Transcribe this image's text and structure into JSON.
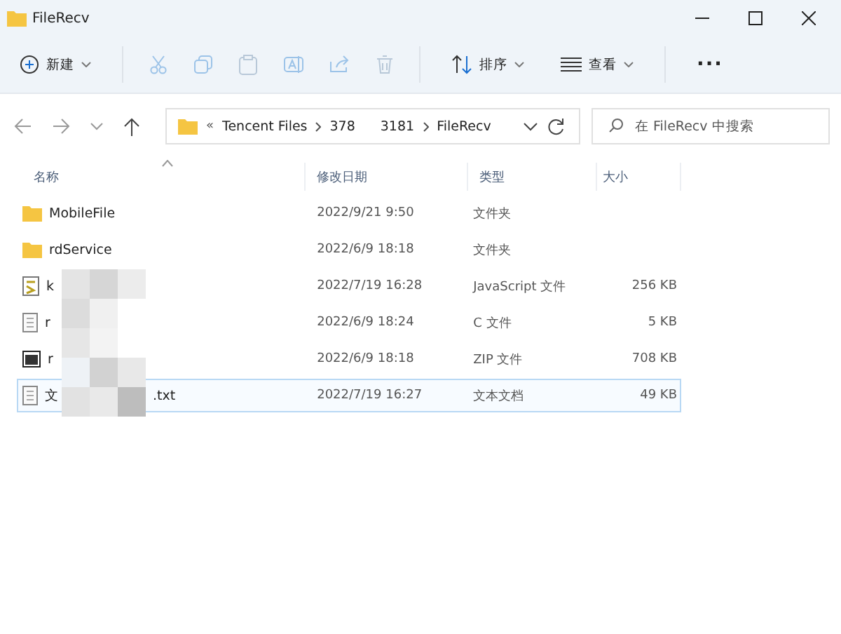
{
  "window": {
    "title": "FileRecv"
  },
  "toolbar": {
    "new_label": "新建",
    "sort_label": "排序",
    "view_label": "查看",
    "more": "···"
  },
  "address": {
    "prefix": "«",
    "crumbs": [
      "Tencent Files",
      "378",
      "3181",
      "FileRecv"
    ]
  },
  "search": {
    "placeholder": "在 FileRecv 中搜索"
  },
  "table": {
    "columns": [
      "名称",
      "修改日期",
      "类型",
      "大小"
    ],
    "rows": [
      {
        "kind": "folder",
        "name": "MobileFile",
        "suffix": "",
        "date": "2022/9/21 9:50",
        "type": "文件夹",
        "size": "",
        "selected": false
      },
      {
        "kind": "folder",
        "name": "rdService",
        "suffix": "",
        "date": "2022/6/9 18:18",
        "type": "文件夹",
        "size": "",
        "selected": false
      },
      {
        "kind": "js",
        "name": "k",
        "suffix": "",
        "date": "2022/7/19 16:28",
        "type": "JavaScript 文件",
        "size": "256 KB",
        "selected": false
      },
      {
        "kind": "c",
        "name": "r",
        "suffix": "",
        "date": "2022/6/9 18:24",
        "type": "C 文件",
        "size": "5 KB",
        "selected": false
      },
      {
        "kind": "zip",
        "name": "r",
        "suffix": "",
        "date": "2022/6/9 18:18",
        "type": "ZIP 文件",
        "size": "708 KB",
        "selected": false
      },
      {
        "kind": "txt",
        "name": "文",
        "suffix": ".txt",
        "date": "2022/7/19 16:27",
        "type": "文本文档",
        "size": "49 KB",
        "selected": true
      }
    ]
  }
}
